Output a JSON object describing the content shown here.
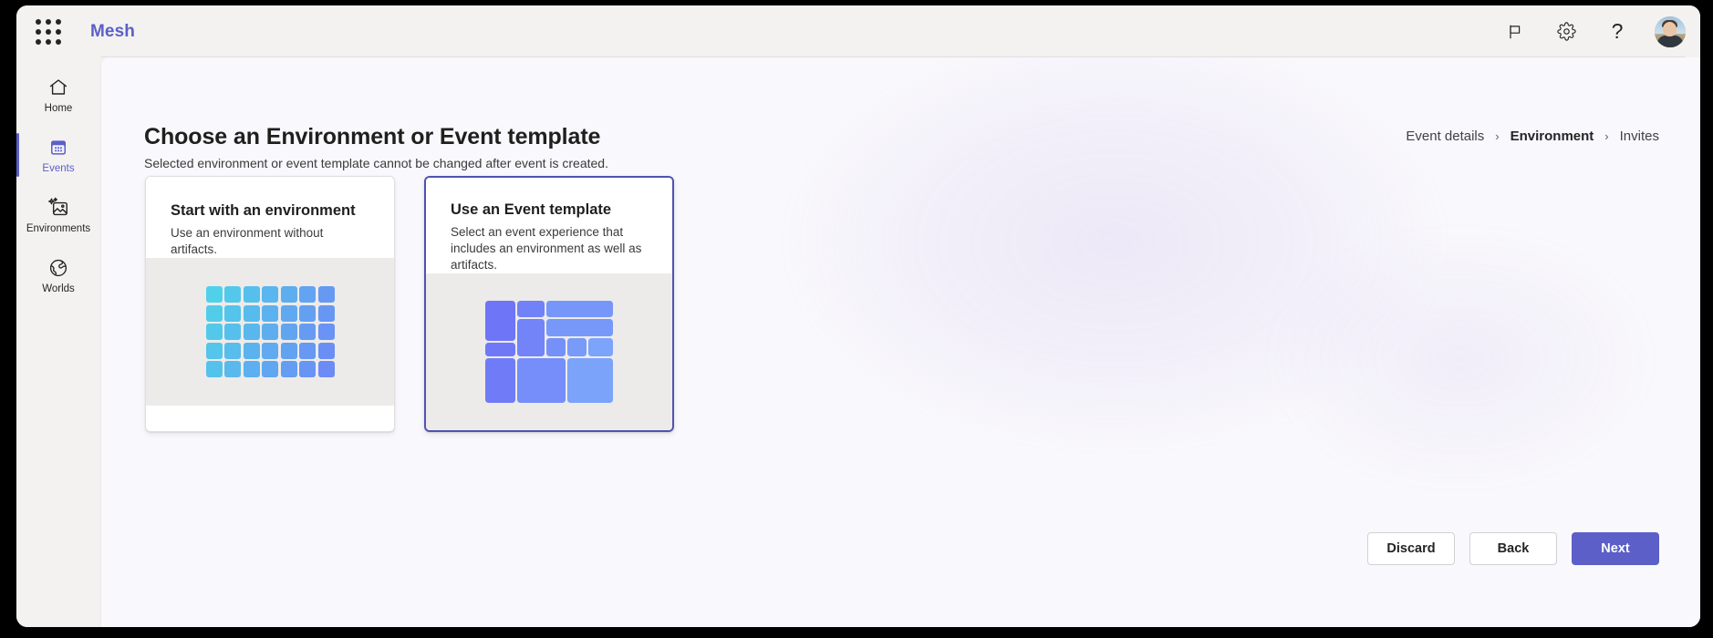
{
  "header": {
    "waffle_icon": "app-launcher-icon",
    "brand": "Mesh",
    "actions": [
      {
        "icon": "flag-icon",
        "label": "Flag"
      },
      {
        "icon": "gear-icon",
        "label": "Settings"
      },
      {
        "icon": "help-icon",
        "label": "?"
      }
    ],
    "avatar_label": "Account manager"
  },
  "sidebar": {
    "items": [
      {
        "label": "Home",
        "icon": "home-icon",
        "active": false
      },
      {
        "label": "Events",
        "icon": "calendar-icon",
        "active": true
      },
      {
        "label": "Environments",
        "icon": "image-spark-icon",
        "active": false
      },
      {
        "label": "Worlds",
        "icon": "globe-icon",
        "active": false
      }
    ]
  },
  "page": {
    "title": "Choose an Environment or Event template",
    "subtitle": "Selected environment or event template cannot be changed after event is created."
  },
  "breadcrumb": {
    "items": [
      {
        "label": "Event details",
        "current": false
      },
      {
        "label": "Environment",
        "current": true
      },
      {
        "label": "Invites",
        "current": false
      }
    ],
    "separator": "›"
  },
  "cards": [
    {
      "title": "Start with an environment",
      "description": "Use an environment without artifacts.",
      "selected": false,
      "art": "grid-thumbnail"
    },
    {
      "title": "Use an Event template",
      "description": "Select an event experience that includes an environment as well as artifacts.",
      "selected": true,
      "art": "mosaic-thumbnail"
    }
  ],
  "footer": {
    "discard_label": "Discard",
    "back_label": "Back",
    "next_label": "Next"
  },
  "colors": {
    "accent": "#5B5FC7",
    "selected_border": "#4F52B2",
    "surface": "#F9F8FC",
    "rail": "#F3F2F1",
    "art_bg": "#EDEBE9",
    "grid_art_from": "#4FD1E9",
    "grid_art_to": "#6C8BF5",
    "mosaic_art_from": "#6B6CF6",
    "mosaic_art_to": "#7FB0FB"
  }
}
